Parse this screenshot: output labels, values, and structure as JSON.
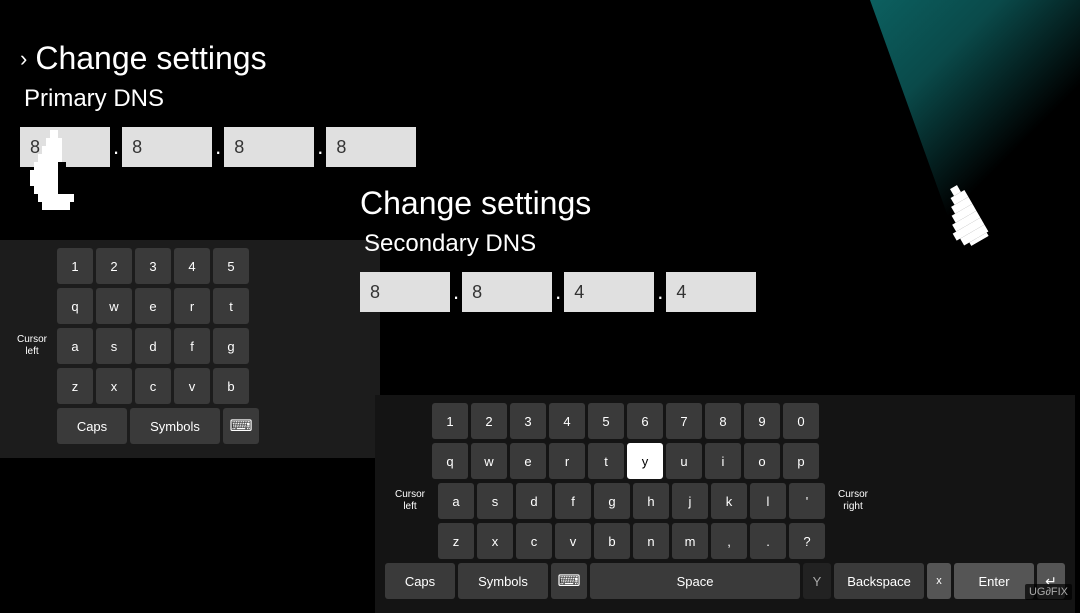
{
  "background": {
    "color": "#000000"
  },
  "primary_panel": {
    "chevron": "›",
    "title": "Change settings",
    "subtitle": "Primary DNS",
    "inputs": [
      "8",
      "8",
      "8",
      "8"
    ]
  },
  "secondary_panel": {
    "title": "Change settings",
    "subtitle": "Secondary DNS",
    "inputs": [
      "8",
      "8",
      "4",
      "4"
    ]
  },
  "keyboard_primary": {
    "row_numbers": [
      "1",
      "2",
      "3",
      "4",
      "5"
    ],
    "row_qwerty": [
      "q",
      "w",
      "e",
      "r",
      "t"
    ],
    "row_asdf": [
      "a",
      "s",
      "d",
      "f",
      "g"
    ],
    "row_zxcv": [
      "z",
      "x",
      "c",
      "v",
      "b"
    ],
    "cursor_left_label": "Cursor\nleft",
    "caps_label": "Caps",
    "symbols_label": "Symbols"
  },
  "keyboard_secondary": {
    "row_numbers": [
      "1",
      "2",
      "3",
      "4",
      "5",
      "6",
      "7",
      "8",
      "9",
      "0"
    ],
    "row_qwerty": [
      "q",
      "w",
      "e",
      "r",
      "t",
      "y",
      "u",
      "i",
      "o",
      "p"
    ],
    "row_asdf": [
      "a",
      "s",
      "d",
      "f",
      "g",
      "h",
      "j",
      "k",
      "l",
      "'"
    ],
    "row_zxcv": [
      "z",
      "x",
      "c",
      "v",
      "b",
      "n",
      "m",
      ",",
      ".",
      "?"
    ],
    "cursor_left_label": "Cursor\nleft",
    "cursor_right_label": "Cursor\nright",
    "caps_label": "Caps",
    "symbols_label": "Symbols",
    "space_label": "Space",
    "backspace_label": "Backspace",
    "enter_label": "Enter",
    "highlighted_key": "y"
  },
  "logo": "UG∂FIX"
}
